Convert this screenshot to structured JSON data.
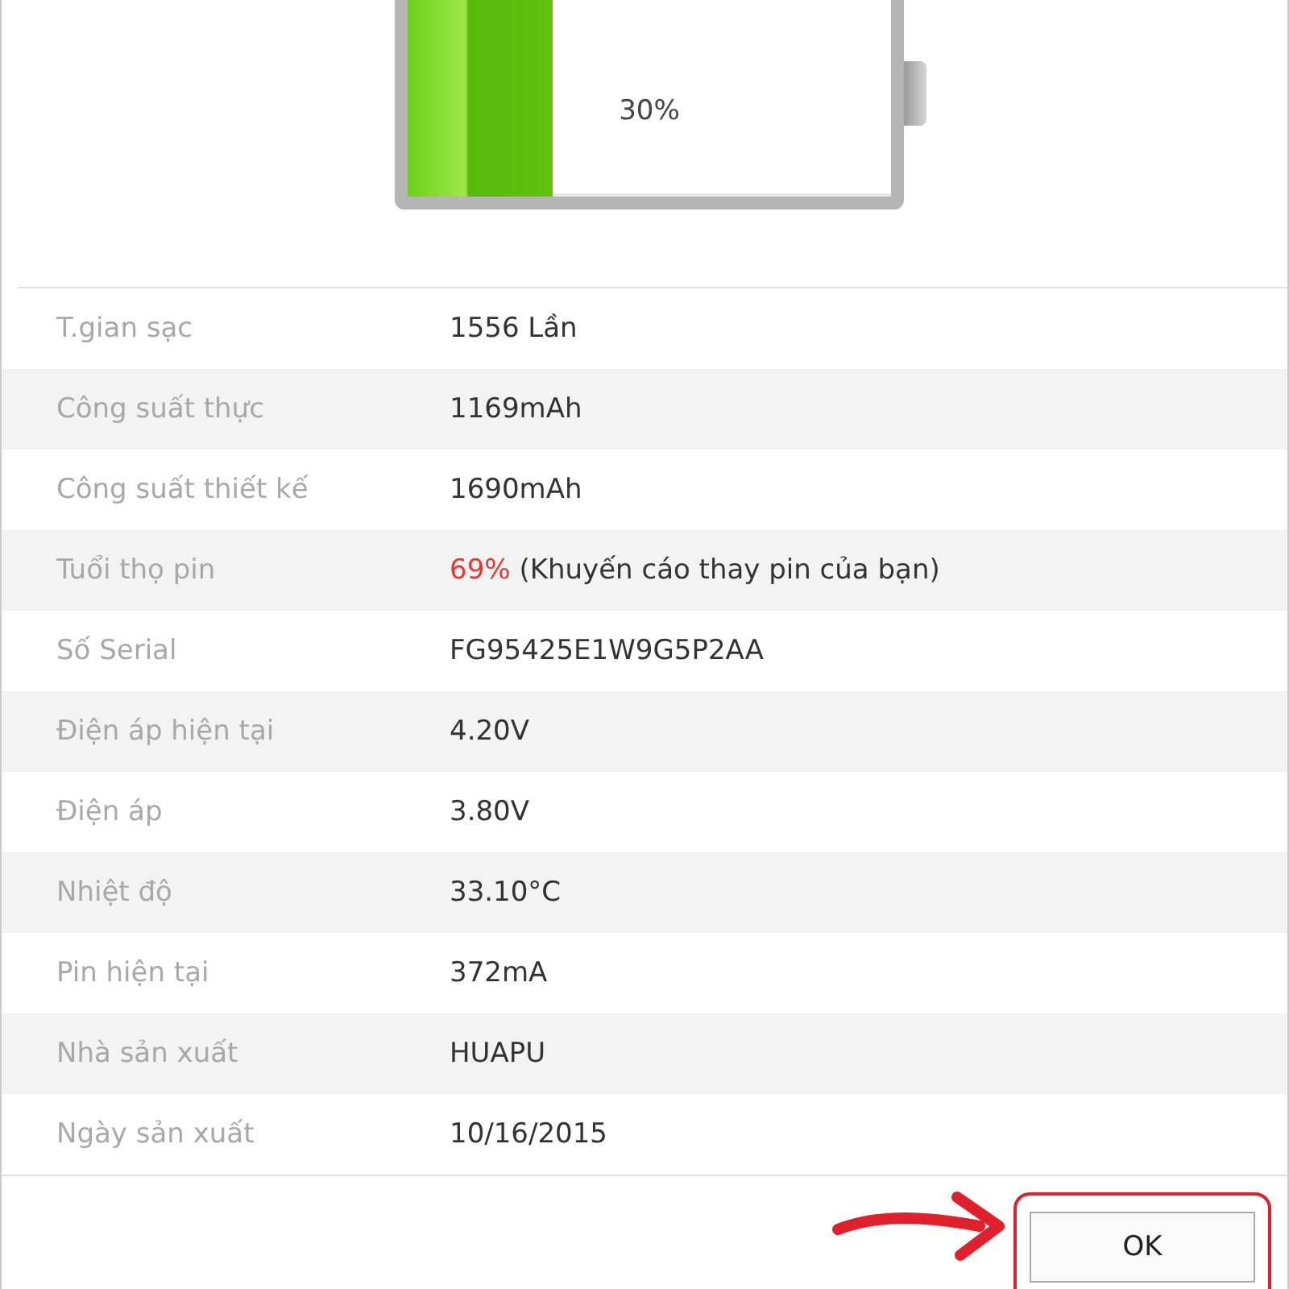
{
  "battery": {
    "reading": "30%"
  },
  "rows": [
    {
      "kind": "plain",
      "label": "T.gian sạc",
      "value": "1556 Lần"
    },
    {
      "kind": "plain",
      "label": "Công suất thực",
      "value": "1169mAh"
    },
    {
      "kind": "plain",
      "label": "Công suất thiết kế",
      "value": "1690mAh"
    },
    {
      "kind": "warning",
      "label": "Tuổi thọ pin",
      "value": "69%",
      "note": "(Khuyến cáo thay pin của bạn)"
    },
    {
      "kind": "plain",
      "label": "Số Serial",
      "value": "FG95425E1W9G5P2AA"
    },
    {
      "kind": "plain",
      "label": "Điện áp hiện tại",
      "value": "4.20V"
    },
    {
      "kind": "plain",
      "label": "Điện áp",
      "value": "3.80V"
    },
    {
      "kind": "plain",
      "label": "Nhiệt độ",
      "value": "33.10°C"
    },
    {
      "kind": "plain",
      "label": "Pin hiện tại",
      "value": "372mA"
    },
    {
      "kind": "plain",
      "label": "Nhà sản xuất",
      "value": "HUAPU"
    },
    {
      "kind": "plain",
      "label": "Ngày sản xuất",
      "value": "10/16/2015"
    }
  ],
  "buttons": [
    "OK"
  ]
}
